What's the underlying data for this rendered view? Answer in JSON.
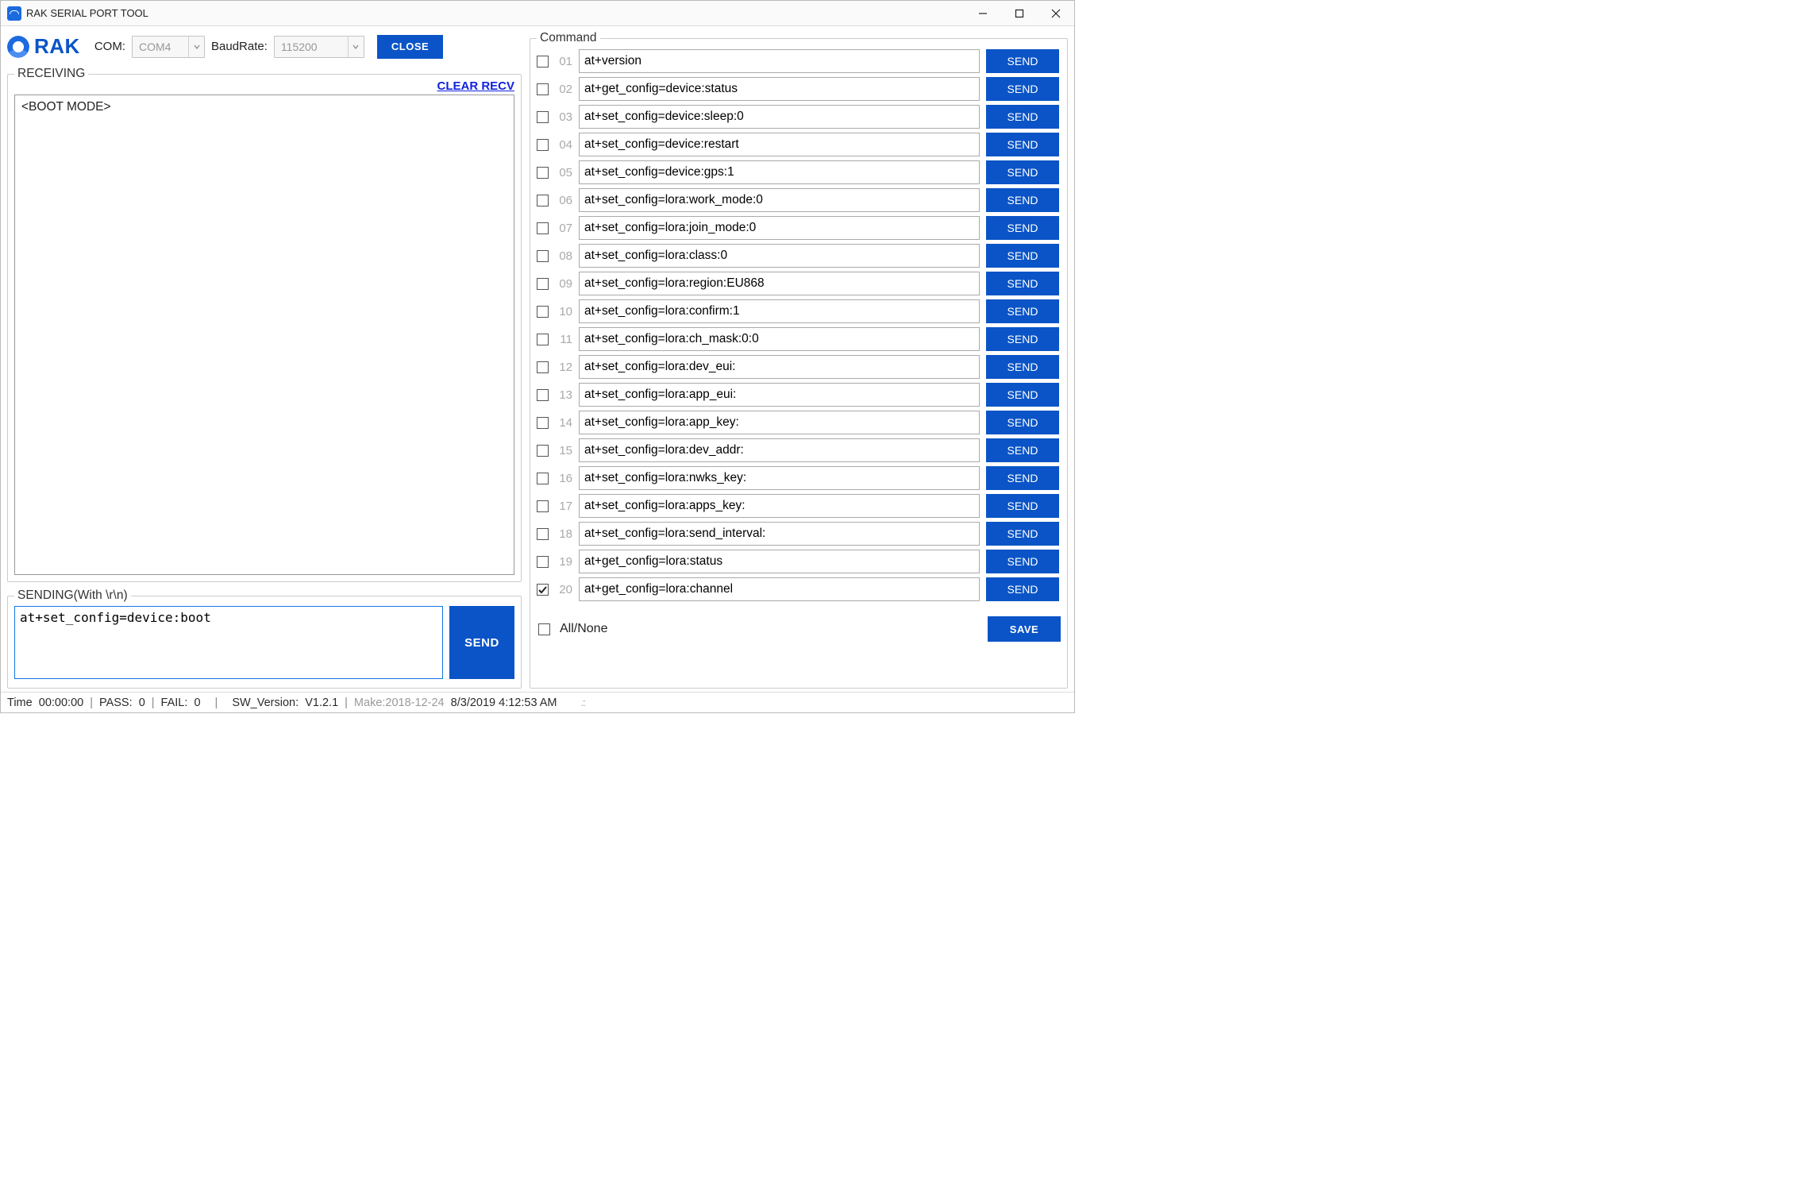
{
  "titlebar": {
    "title": "RAK SERIAL PORT TOOL"
  },
  "logo": {
    "text": "RAK"
  },
  "conn": {
    "com_label": "COM:",
    "com_value": "COM4",
    "baud_label": "BaudRate:",
    "baud_value": "115200",
    "close_label": "CLOSE"
  },
  "receiving": {
    "legend": "RECEIVING",
    "clear_label": "CLEAR RECV",
    "content": "<BOOT MODE>"
  },
  "sending": {
    "legend": "SENDING(With \\r\\n)",
    "value": "at+set_config=device:boot",
    "send_label": "SEND"
  },
  "command": {
    "legend": "Command",
    "row_send_label": "SEND",
    "rows": [
      {
        "num": "01",
        "checked": false,
        "text": "at+version"
      },
      {
        "num": "02",
        "checked": false,
        "text": "at+get_config=device:status"
      },
      {
        "num": "03",
        "checked": false,
        "text": "at+set_config=device:sleep:0"
      },
      {
        "num": "04",
        "checked": false,
        "text": "at+set_config=device:restart"
      },
      {
        "num": "05",
        "checked": false,
        "text": "at+set_config=device:gps:1"
      },
      {
        "num": "06",
        "checked": false,
        "text": "at+set_config=lora:work_mode:0"
      },
      {
        "num": "07",
        "checked": false,
        "text": "at+set_config=lora:join_mode:0"
      },
      {
        "num": "08",
        "checked": false,
        "text": "at+set_config=lora:class:0"
      },
      {
        "num": "09",
        "checked": false,
        "text": "at+set_config=lora:region:EU868"
      },
      {
        "num": "10",
        "checked": false,
        "text": "at+set_config=lora:confirm:1"
      },
      {
        "num": "11",
        "checked": false,
        "text": "at+set_config=lora:ch_mask:0:0"
      },
      {
        "num": "12",
        "checked": false,
        "text": "at+set_config=lora:dev_eui:"
      },
      {
        "num": "13",
        "checked": false,
        "text": "at+set_config=lora:app_eui:"
      },
      {
        "num": "14",
        "checked": false,
        "text": "at+set_config=lora:app_key:"
      },
      {
        "num": "15",
        "checked": false,
        "text": "at+set_config=lora:dev_addr:"
      },
      {
        "num": "16",
        "checked": false,
        "text": "at+set_config=lora:nwks_key:"
      },
      {
        "num": "17",
        "checked": false,
        "text": "at+set_config=lora:apps_key:"
      },
      {
        "num": "18",
        "checked": false,
        "text": "at+set_config=lora:send_interval:"
      },
      {
        "num": "19",
        "checked": false,
        "text": "at+get_config=lora:status"
      },
      {
        "num": "20",
        "checked": true,
        "text": "at+get_config=lora:channel"
      }
    ],
    "allnone": {
      "checked": false,
      "label": "All/None"
    },
    "save_label": "SAVE"
  },
  "status": {
    "time_label": "Time",
    "time_value": "00:00:00",
    "pass_label": "PASS:",
    "pass_value": "0",
    "fail_label": "FAIL:",
    "fail_value": "0",
    "sw_label": "SW_Version:",
    "sw_value": "V1.2.1",
    "make_label": "Make:",
    "make_value": "2018-12-24",
    "datetime": "8/3/2019 4:12:53 AM"
  }
}
